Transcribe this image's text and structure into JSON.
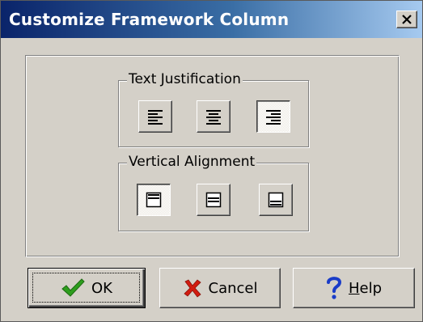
{
  "window": {
    "title": "Customize Framework Column",
    "close_glyph": "close-x-icon"
  },
  "text_justification": {
    "label": "Text Justification",
    "options": [
      {
        "name": "left",
        "icon": "align-left-icon",
        "selected": false
      },
      {
        "name": "center",
        "icon": "align-center-icon",
        "selected": false
      },
      {
        "name": "right",
        "icon": "align-right-icon",
        "selected": true
      }
    ]
  },
  "vertical_alignment": {
    "label": "Vertical Alignment",
    "options": [
      {
        "name": "top",
        "icon": "valign-top-icon",
        "selected": true
      },
      {
        "name": "middle",
        "icon": "valign-middle-icon",
        "selected": false
      },
      {
        "name": "bottom",
        "icon": "valign-bottom-icon",
        "selected": false
      }
    ]
  },
  "buttons": {
    "ok": {
      "label": "OK",
      "icon": "checkmark-icon",
      "icon_color": "#2e9e1e"
    },
    "cancel": {
      "label": "Cancel",
      "icon": "red-x-icon",
      "icon_color": "#d21c10"
    },
    "help": {
      "label_underlined": "H",
      "label_rest": "elp",
      "icon": "question-mark-icon",
      "icon_color": "#1a3cc8"
    }
  },
  "colors": {
    "titlebar_start": "#0a246a",
    "titlebar_end": "#a6caf0",
    "face": "#d4d0c8"
  }
}
